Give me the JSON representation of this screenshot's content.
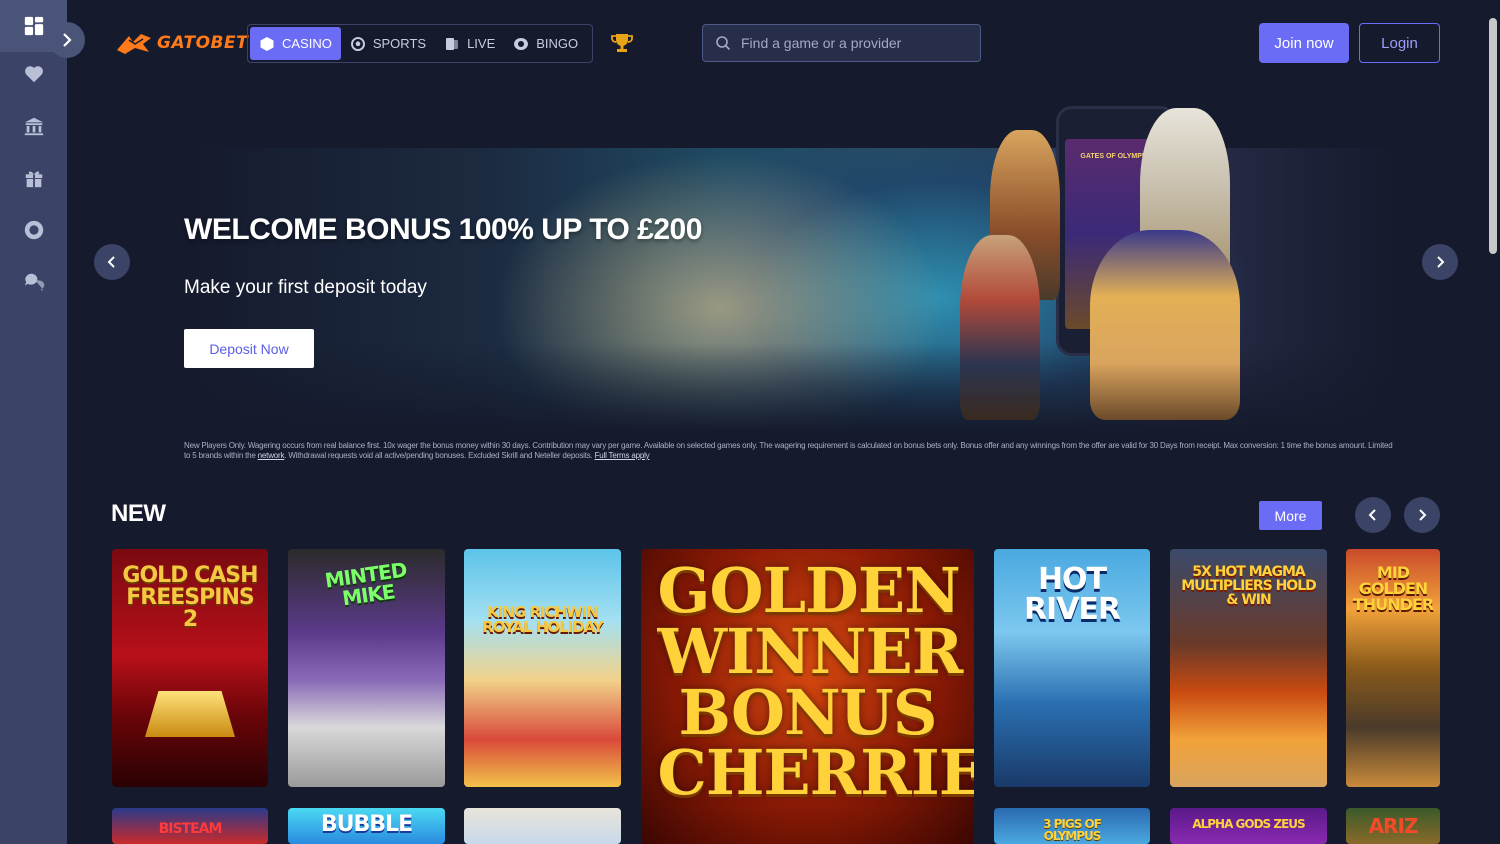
{
  "sidebar": {
    "items": [
      {
        "name": "grid-icon"
      },
      {
        "name": "heart-icon"
      },
      {
        "name": "casino-building-icon"
      },
      {
        "name": "gift-icon"
      },
      {
        "name": "lifebuoy-icon"
      },
      {
        "name": "support-chat-icon"
      }
    ]
  },
  "header": {
    "logo_text": "GATOBET",
    "nav": [
      {
        "label": "CASINO",
        "icon": "dice-icon",
        "active": true
      },
      {
        "label": "SPORTS",
        "icon": "soccer-ball-icon",
        "active": false
      },
      {
        "label": "LIVE",
        "icon": "cards-icon",
        "active": false
      },
      {
        "label": "BINGO",
        "icon": "bingo-ball-icon",
        "active": false
      }
    ],
    "search_placeholder": "Find a game or a provider",
    "join_label": "Join now",
    "login_label": "Login"
  },
  "banner": {
    "title": "WELCOME BONUS 100% UP TO £200",
    "subtitle": "Make your first deposit today",
    "cta": "Deposit Now",
    "phone_screen_text": "GATES OF OLYMPUS",
    "disclaimer_main": "New Players Only. Wagering occurs from real balance first. 10x wager the bonus money within 30 days. Contribution may vary per game. Available on selected games only. The wagering requirement is calculated on bonus bets only. Bonus offer and any winnings from the offer are valid for 30 Days from receipt. Max conversion: 1 time the bonus amount. Limited to 5 brands within the ",
    "disclaimer_link": "network",
    "disclaimer_tail": ". Withdrawal requests void all active/pending bonuses. Excluded Skrill and Neteller deposits. ",
    "disclaimer_terms": "Full Terms apply"
  },
  "new_section": {
    "title": "NEW",
    "more_label": "More",
    "games": [
      {
        "title": "GOLD CASH FREESPINS 2"
      },
      {
        "title": "MINTED MIKE"
      },
      {
        "title": "KING RICHWIN ROYAL HOLIDAY"
      },
      {
        "title": "GOLDEN WINNER BONUS CHERRIES"
      },
      {
        "title": "HOT RIVER"
      },
      {
        "title": "5X HOT MAGMA MULTIPLIERS HOLD & WIN"
      },
      {
        "title": "MID GOLDEN THUNDER"
      }
    ],
    "next_row": [
      {
        "title": "BISTEAM"
      },
      {
        "title": "BUBBLE"
      },
      {
        "title": ""
      },
      {
        "title": "3 PIGS OF OLYMPUS"
      },
      {
        "title": "ALPHA GODS ZEUS"
      },
      {
        "title": "ARIZ"
      }
    ]
  },
  "colors": {
    "accent": "#6a6cf6",
    "background": "#151a2c",
    "sidebar": "#3b4467",
    "logo": "#ff7a1a"
  }
}
